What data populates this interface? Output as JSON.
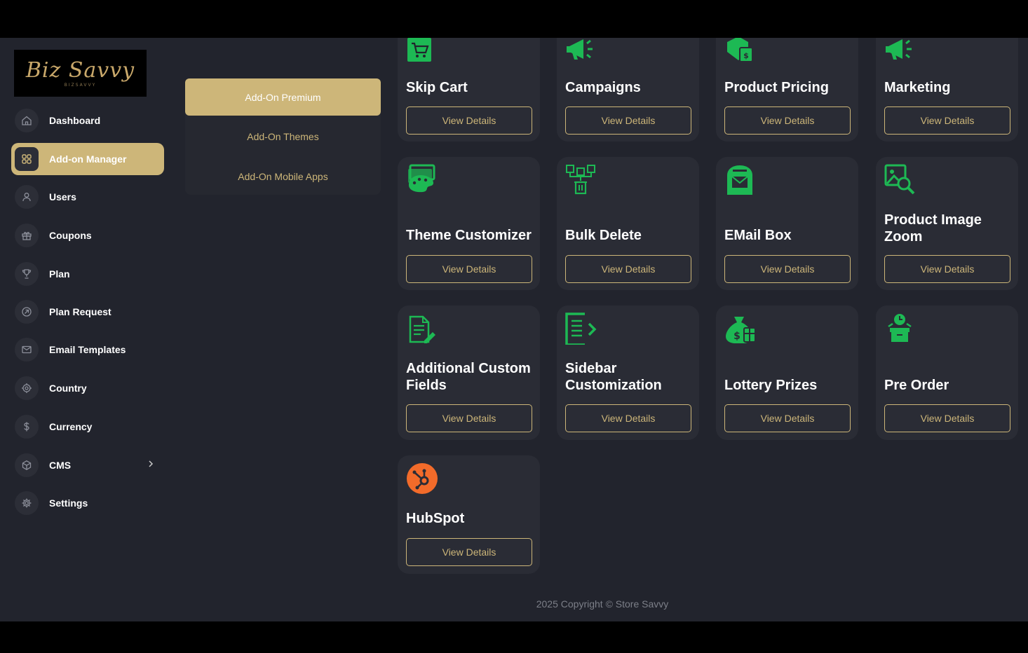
{
  "logo": {
    "script": "Biz Savvy",
    "sub": "BIZSAVVY"
  },
  "sidebar": {
    "items": [
      {
        "label": "Dashboard",
        "icon": "home-icon"
      },
      {
        "label": "Add-on Manager",
        "icon": "grid-icon",
        "active": true
      },
      {
        "label": "Users",
        "icon": "user-icon"
      },
      {
        "label": "Coupons",
        "icon": "gift-icon"
      },
      {
        "label": "Plan",
        "icon": "trophy-icon"
      },
      {
        "label": "Plan Request",
        "icon": "arrow-circle-icon"
      },
      {
        "label": "Email Templates",
        "icon": "mail-icon"
      },
      {
        "label": "Country",
        "icon": "target-icon"
      },
      {
        "label": "Currency",
        "icon": "dollar-icon"
      },
      {
        "label": "CMS",
        "icon": "cube-icon"
      },
      {
        "label": "Settings",
        "icon": "gear-icon"
      }
    ]
  },
  "submenu": {
    "items": [
      {
        "label": "Add-On Premium",
        "active": true
      },
      {
        "label": "Add-On Themes"
      },
      {
        "label": "Add-On Mobile Apps"
      }
    ]
  },
  "cards": [
    {
      "title": "Skip Cart",
      "button": "View Details",
      "icon": "cart-icon"
    },
    {
      "title": "Campaigns",
      "button": "View Details",
      "icon": "megaphone-icon"
    },
    {
      "title": "Product Pricing",
      "button": "View Details",
      "icon": "price-tag-icon"
    },
    {
      "title": "Marketing",
      "button": "View Details",
      "icon": "megaphone-icon"
    },
    {
      "title": "Theme Customizer",
      "button": "View Details",
      "icon": "palette-icon"
    },
    {
      "title": "Bulk Delete",
      "button": "View Details",
      "icon": "bulk-delete-icon"
    },
    {
      "title": "EMail Box",
      "button": "View Details",
      "icon": "mailbox-icon"
    },
    {
      "title": "Product Image Zoom",
      "button": "View Details",
      "icon": "image-zoom-icon"
    },
    {
      "title": "Additional Custom Fields",
      "button": "View Details",
      "icon": "document-edit-icon"
    },
    {
      "title": "Sidebar Customization",
      "button": "View Details",
      "icon": "sidebar-icon"
    },
    {
      "title": "Lottery Prizes",
      "button": "View Details",
      "icon": "money-bag-icon"
    },
    {
      "title": "Pre Order",
      "button": "View Details",
      "icon": "pre-order-box-icon"
    },
    {
      "title": "HubSpot",
      "button": "View Details",
      "icon": "hubspot-icon"
    }
  ],
  "footer": "2025 Copyright © Store Savvy",
  "colors": {
    "accent": "#cdb679",
    "green": "#1db954",
    "hubspot": "#f26b2a",
    "bg": "#22242d",
    "card": "#2a2c35"
  }
}
